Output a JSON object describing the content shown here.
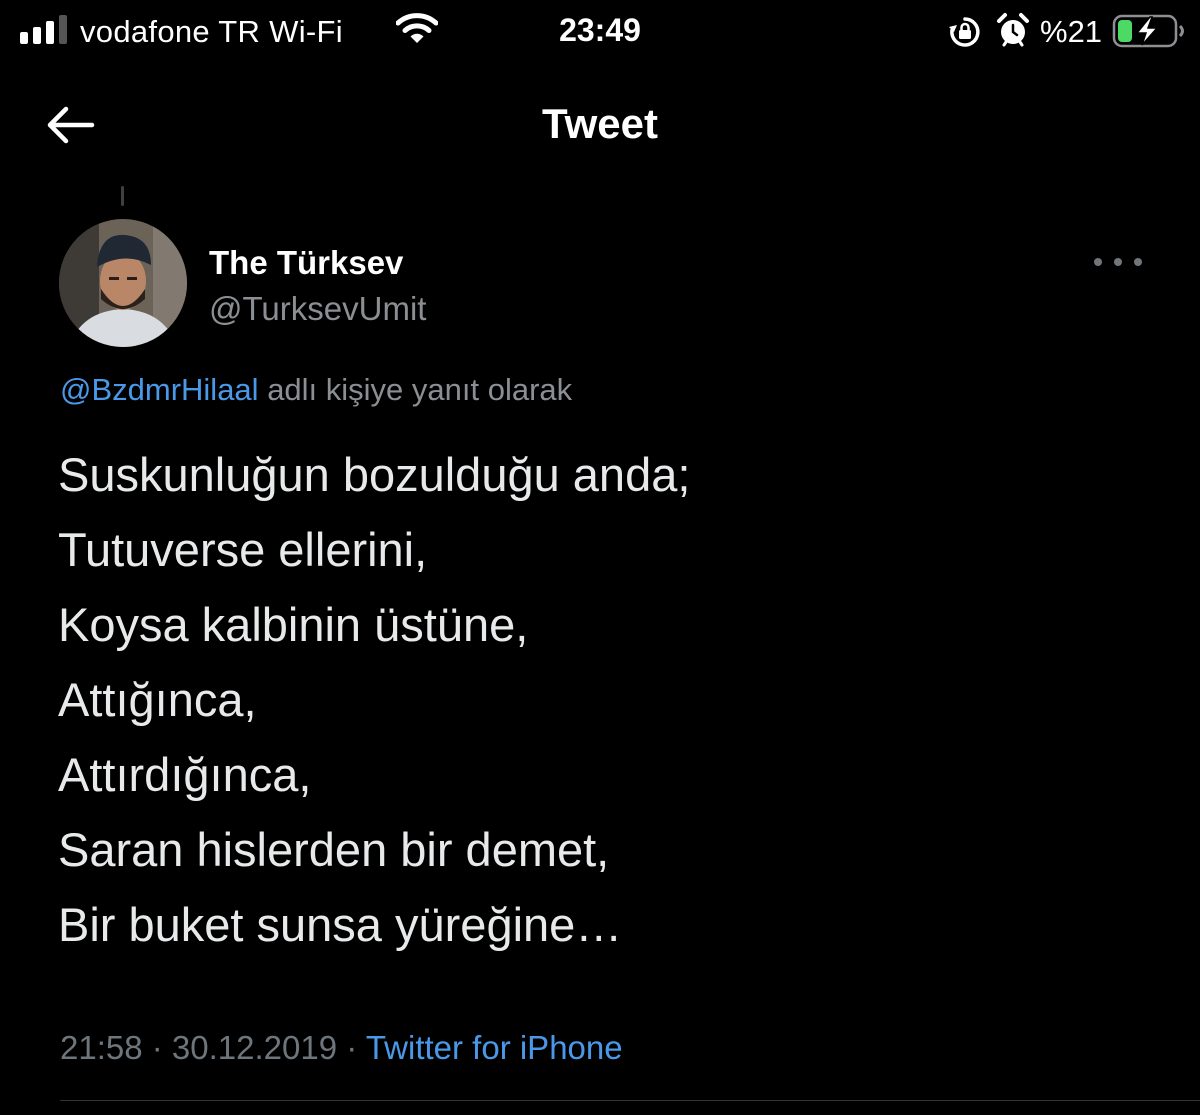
{
  "status_bar": {
    "carrier": "vodafone TR Wi-Fi",
    "time": "23:49",
    "battery_percent": "%21",
    "signal_bars_filled": 3,
    "signal_bars_total": 4,
    "battery_level": 0.21,
    "battery_charging": true,
    "icons": [
      "signal-icon",
      "wifi-icon",
      "orientation-lock-icon",
      "alarm-icon",
      "battery-charging-icon"
    ]
  },
  "nav": {
    "title": "Tweet",
    "back_icon": "arrow-left-icon"
  },
  "tweet": {
    "author": {
      "display_name": "The Türksev",
      "handle": "@TurksevUmit"
    },
    "reply_to": {
      "mention": "@BzdmrHilaal",
      "suffix": " adlı kişiye yanıt olarak"
    },
    "lines": [
      "Suskunluğun bozulduğu anda;",
      "Tutuverse ellerini,",
      "Koysa kalbinin üstüne,",
      "Attığınca,",
      "Attırdığınca,",
      "Saran hislerden bir demet,",
      "Bir buket sunsa yüreğine…"
    ],
    "time": "21:58",
    "separator": " · ",
    "date": "30.12.2019",
    "source": "Twitter for iPhone"
  },
  "colors": {
    "background": "#000000",
    "text": "#e7e9ea",
    "secondary": "#8b8f94",
    "link": "#4a99e9",
    "battery_green": "#4cd964"
  }
}
